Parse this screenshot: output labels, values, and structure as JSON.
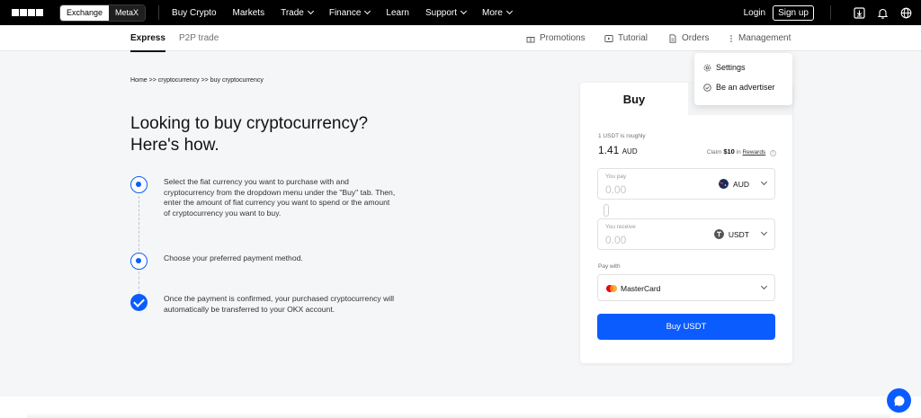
{
  "topbar": {
    "switch": {
      "exchange": "Exchange",
      "metax": "MetaX"
    },
    "nav": [
      {
        "label": "Buy Crypto",
        "has_dropdown": false
      },
      {
        "label": "Markets",
        "has_dropdown": false
      },
      {
        "label": "Trade",
        "has_dropdown": true
      },
      {
        "label": "Finance",
        "has_dropdown": true
      },
      {
        "label": "Learn",
        "has_dropdown": false
      },
      {
        "label": "Support",
        "has_dropdown": true
      },
      {
        "label": "More",
        "has_dropdown": true
      }
    ],
    "login": "Login",
    "signup": "Sign up",
    "icons": [
      "download-icon",
      "bell-icon",
      "globe-icon"
    ]
  },
  "subnav": {
    "tabs": [
      "Express",
      "P2P trade"
    ],
    "links": [
      "Promotions",
      "Tutorial",
      "Orders",
      "Management"
    ]
  },
  "management_menu": [
    "Settings",
    "Be an advertiser"
  ],
  "breadcrumb": "Home >> cryptocurrency >> buy cryptocurrency",
  "headline": {
    "line1": "Looking to buy cryptocurrency?",
    "line2": "Here's how."
  },
  "steps": [
    "Select the fiat currency you want to purchase with and cryptocurrency from the dropdown menu under the \"Buy\" tab. Then, enter the amount of fiat currency you want to spend or the amount of cryptocurrency you want to buy.",
    "Choose your preferred payment method.",
    "Once the payment is confirmed, your purchased cryptocurrency will automatically be transferred to your OKX account."
  ],
  "buy_card": {
    "tab": "Buy",
    "rate_label": "1 USDT is roughly",
    "rate_value": "1.41",
    "rate_unit": "AUD",
    "claim_prefix": "Claim",
    "claim_amount": "$10",
    "claim_in": "in",
    "claim_link": "Rewards",
    "pay_label": "You pay",
    "pay_placeholder": "0.00",
    "pay_currency": "AUD",
    "receive_label": "You receive",
    "receive_placeholder": "0.00",
    "receive_currency": "USDT",
    "paywith_label": "Pay with",
    "payment_method": "MasterCard",
    "button": "Buy USDT"
  },
  "colors": {
    "accent": "#0b5cff",
    "topbar": "#000000",
    "background": "#f5f6f8"
  }
}
